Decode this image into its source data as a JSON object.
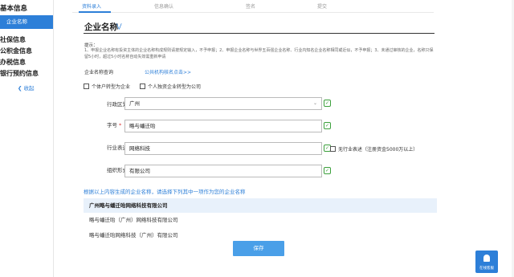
{
  "sidebar": {
    "title": "基本信息",
    "active_item": "企业名称",
    "items": [
      "社保信息",
      "公积金信息",
      "办税信息",
      "银行预约信息"
    ],
    "collapse": "收起"
  },
  "steps": [
    "资料录入",
    "信息确认",
    "签名",
    "提交"
  ],
  "section": {
    "title": "企业名称",
    "tip_label": "提示：",
    "tip_text": "1、申报企业名称有投资主体的企业名称构成规则请按规定输入，不予申报；2、申报企业名称与世界五百强企业名称、行业内知名企业名称相同或近似，不予申报；3、未通过审核的企业，名称只保留5小时，超过5小时名称自动失效需重新申请"
  },
  "query": {
    "label": "企业名称查询",
    "link": "公共机构核名点击>>"
  },
  "checkboxes": [
    "个体户转型为企业",
    "个人独资企业转型为公司"
  ],
  "form": {
    "region": {
      "label": "行政区划",
      "value": "广州"
    },
    "brand": {
      "label": "字号",
      "value": "略与蟠迁咍"
    },
    "industry": {
      "label": "行业表述",
      "value": "网络科技"
    },
    "org": {
      "label": "组织形式",
      "value": "有限公司"
    },
    "no_industry": "无行业表述（注册资金5000万以上）"
  },
  "choose_text": "根据以上内容生成的企业名称，请选择下列其中一项作为您的企业名称",
  "options": [
    "广州略与蟠迁咍网络科技有限公司",
    "略与蟠迁咍（广州）网络科技有限公司",
    "略与蟠迁咍网络科技（广州）有限公司"
  ],
  "save_label": "保存",
  "service_label": "在线客服",
  "colors": {
    "accent": "#2d7fd8",
    "valid": "#3ca03c",
    "required": "#d33333"
  }
}
